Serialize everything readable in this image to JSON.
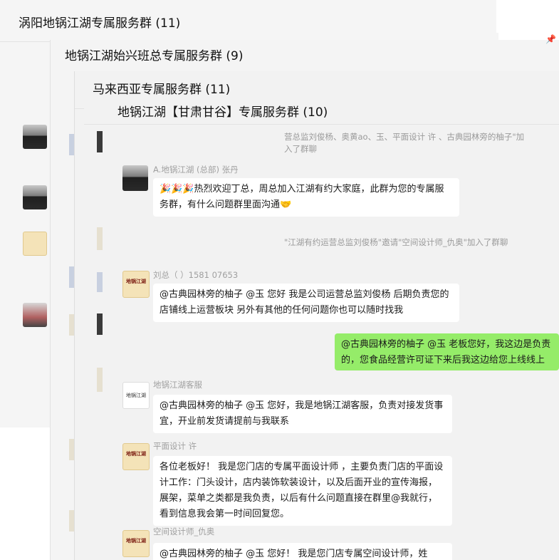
{
  "windows": [
    {
      "title": "涡阳地锅江湖专属服务群 (11)"
    },
    {
      "title": "地锅江湖始兴班总专属服务群 (9)"
    },
    {
      "title": "马来西亚专属服务群 (11)"
    },
    {
      "title": "地锅江湖【甘肃甘谷】专属服务群 (10)"
    }
  ],
  "pin_icon": "pin-icon",
  "system_messages": [
    {
      "text": "营总监刘俊杨、奥黄ao、玉、平面设计 许  、古典园林旁的柚子\"加入了群聊"
    },
    {
      "text": "\"江湖有约运营总监刘俊杨\"邀请\"空间设计师_仇奥\"加入了群聊"
    }
  ],
  "messages": [
    {
      "sender": "A.地锅江湖 (总部) 张丹",
      "text": "🎉🎉🎉热烈欢迎丁总，周总加入江湖有约大家庭，此群为您的专属服务群，有什么问题群里面沟通🤝"
    },
    {
      "sender": "刘总（      ）1581  07653",
      "text": "@古典园林旁的柚子 @玉 您好 我是公司运营总监刘俊杨 后期负责您的店铺线上运营板块 另外有其他的任何问题你也可以随时找我"
    },
    {
      "sender": "",
      "text": "@古典园林旁的柚子 @玉 老板您好，我这边是负责的，您食品经营许可证下来后我这边给您上线线上"
    },
    {
      "sender": "地锅江湖客服",
      "text": "@古典园林旁的柚子 @玉 您好，我是地锅江湖客服，负责对接发货事宜，开业前发货请提前与我联系"
    },
    {
      "sender": "平面设计 许",
      "text": "各位老板好！ 我是您门店的专属平面设计师      ，主要负责门店的平面设计工作：门头设计，店内装饰软装设计，以及后面开业的宣传海报，展架，菜单之类都是我负责，以后有什么问题直接在群里@我就行，看到信息我会第一时间回复您。"
    },
    {
      "sender": "空间设计师_仇奥",
      "text": "@古典园林旁的柚子 @玉 您好！ 我是您门店专属空间设计师，姓"
    }
  ],
  "logo_text": "地锅江湖",
  "cs_logo_text": "地锅江湖"
}
